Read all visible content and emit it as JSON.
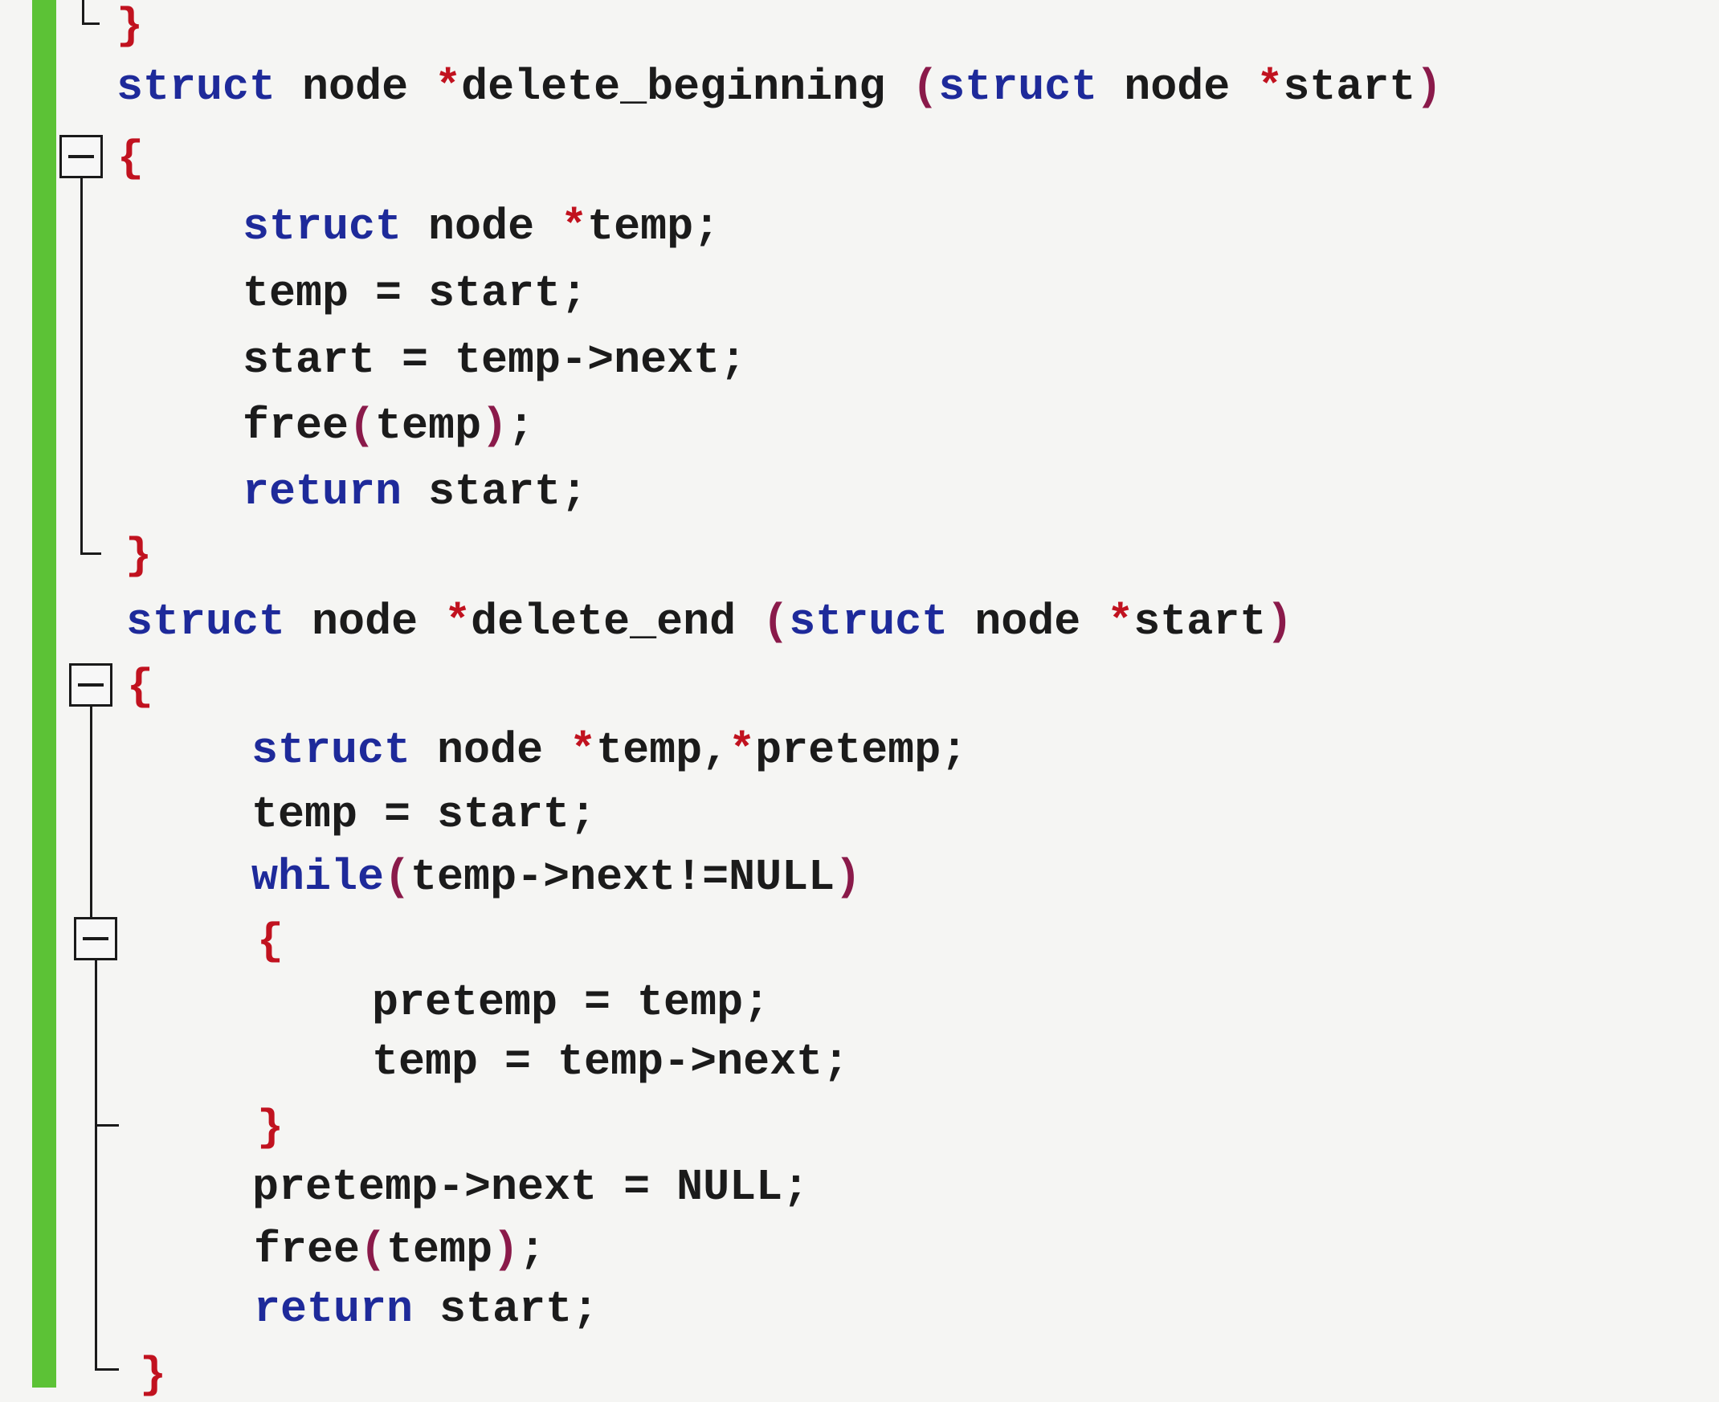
{
  "colors": {
    "gutter_bar": "#5cc236",
    "keyword": "#1e2a9a",
    "pointer_and_brace": "#c1121f",
    "text": "#1b1b1b",
    "background": "#f5f5f3"
  },
  "icons": {
    "fold": "minus-box-icon"
  },
  "code": {
    "prev_close": "}",
    "fn1": {
      "kw_struct": "struct",
      "type": " node ",
      "ptr": "*",
      "name": "delete_beginning ",
      "lparen": "(",
      "kw_struct2": "struct",
      "type2": " node ",
      "ptr2": "*",
      "param": "start",
      "rparen": ")",
      "open": "{",
      "l1_kw": "struct",
      "l1_type": " node ",
      "l1_ptr": "*",
      "l1_rest": "temp;",
      "l2": "temp = start;",
      "l3": "start = temp->next;",
      "l4_a": "free",
      "l4_b": "(",
      "l4_c": "temp",
      "l4_d": ")",
      "l4_e": ";",
      "l5_kw": "return",
      "l5_rest": " start;",
      "close": "}"
    },
    "fn2": {
      "kw_struct": "struct",
      "type": " node ",
      "ptr": "*",
      "name": "delete_end ",
      "lparen": "(",
      "kw_struct2": "struct",
      "type2": " node ",
      "ptr2": "*",
      "param": "start",
      "rparen": ")",
      "open": "{",
      "l1_kw": "struct",
      "l1_type": " node ",
      "l1_ptr": "*",
      "l1_a": "temp,",
      "l1_ptr2": "*",
      "l1_b": "pretemp;",
      "l2": "temp = start;",
      "l3_kw": "while",
      "l3_lp": "(",
      "l3_cond": "temp->next!=NULL",
      "l3_rp": ")",
      "loop_open": "{",
      "l4": "pretemp = temp;",
      "l5": "temp = temp->next;",
      "loop_close": "}",
      "l6": "pretemp->next = NULL;",
      "l7_a": "free",
      "l7_b": "(",
      "l7_c": "temp",
      "l7_d": ")",
      "l7_e": ";",
      "l8_kw": "return",
      "l8_rest": " start;",
      "close": "}"
    }
  }
}
